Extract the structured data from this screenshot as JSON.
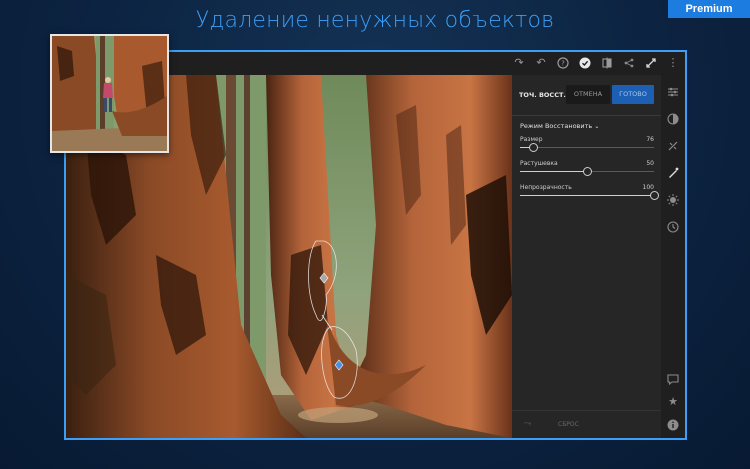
{
  "headline": "Удаление ненужных объектов",
  "premium_badge": "Premium",
  "toolbar": {
    "icons": [
      "redo-icon",
      "undo-icon",
      "help-icon",
      "check-circle-icon",
      "compare-icon",
      "share-icon",
      "fullscreen-icon",
      "more-icon"
    ]
  },
  "panel": {
    "tool_name": "ТОЧ. ВОССТ.",
    "cancel_label": "ОТМЕНА",
    "done_label": "ГОТОВО",
    "mode_label": "Режим Восстановить",
    "sliders": [
      {
        "label": "Размер",
        "value": "76",
        "fraction": 0.1
      },
      {
        "label": "Растушевка",
        "value": "50",
        "fraction": 0.5
      },
      {
        "label": "Непрозрачность",
        "value": "100",
        "fraction": 1.0
      }
    ],
    "reset_label": "СБРОС"
  },
  "sidebar": {
    "icons": [
      "adjust-sliders-icon",
      "color-icon",
      "effects-icon",
      "healing-brush-icon",
      "detail-icon",
      "history-icon",
      "comment-icon",
      "star-icon",
      "info-icon"
    ]
  },
  "colors": {
    "accent": "#3d9ef5",
    "background": "#0c2341",
    "done_button": "#1d5fb3"
  }
}
